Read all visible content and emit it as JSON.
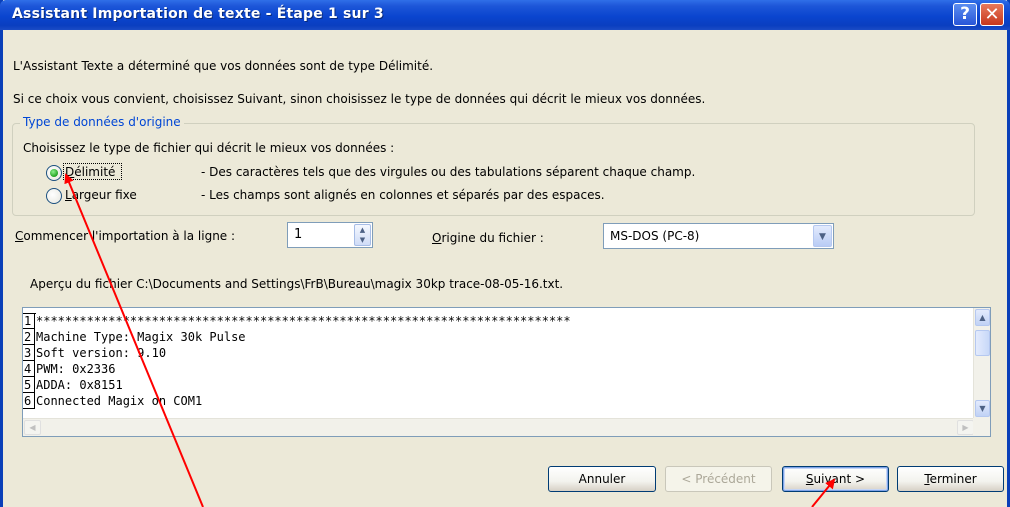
{
  "window": {
    "title": "Assistant Importation de texte - Étape 1 sur 3",
    "help_label": "?",
    "close_label": "✕"
  },
  "intro": {
    "line1": "L'Assistant Texte a déterminé que vos données sont de type Délimité.",
    "line2": "Si ce choix vous convient, choisissez Suivant, sinon choisissez le type de données qui décrit le mieux vos données."
  },
  "original_data_type": {
    "legend": "Type de données d'origine",
    "prompt": "Choisissez le type de fichier qui décrit le mieux vos données :",
    "options": [
      {
        "label_first": "D",
        "label_rest": "élimité",
        "description": "- Des caractères tels que des virgules ou des tabulations séparent chaque champ.",
        "selected": true
      },
      {
        "label_first": "L",
        "label_rest": "argeur fixe",
        "description": "- Les champs sont alignés en colonnes et séparés par des espaces.",
        "selected": false
      }
    ]
  },
  "start_row": {
    "label_first": "C",
    "label_rest": "ommencer l'importation à la ligne :",
    "value": "1"
  },
  "file_origin": {
    "label_first": "O",
    "label_rest": "rigine du fichier :",
    "value": "MS-DOS (PC-8)"
  },
  "preview": {
    "label": "Aperçu du fichier C:\\Documents and Settings\\FrB\\Bureau\\magix 30kp trace-08-05-16.txt.",
    "lines": [
      {
        "num": "1",
        "text": "**************************************************************************"
      },
      {
        "num": "2",
        "text": "Machine Type: Magix 30k Pulse"
      },
      {
        "num": "3",
        "text": "Soft version: 9.10"
      },
      {
        "num": "4",
        "text": "PWM: 0x2336"
      },
      {
        "num": "5",
        "text": "ADDA: 0x8151"
      },
      {
        "num": "6",
        "text": "Connected Magix on COM1"
      }
    ]
  },
  "buttons": {
    "cancel": "Annuler",
    "previous": "< Précédent",
    "next_first": "S",
    "next_rest": "uivant >",
    "finish_first": "T",
    "finish_rest": "erminer"
  },
  "colors": {
    "title_bar": "#0a45cf",
    "window_bg": "#ece9d8",
    "group_legend": "#0046d5",
    "annotation_arrow": "#ff0000"
  }
}
